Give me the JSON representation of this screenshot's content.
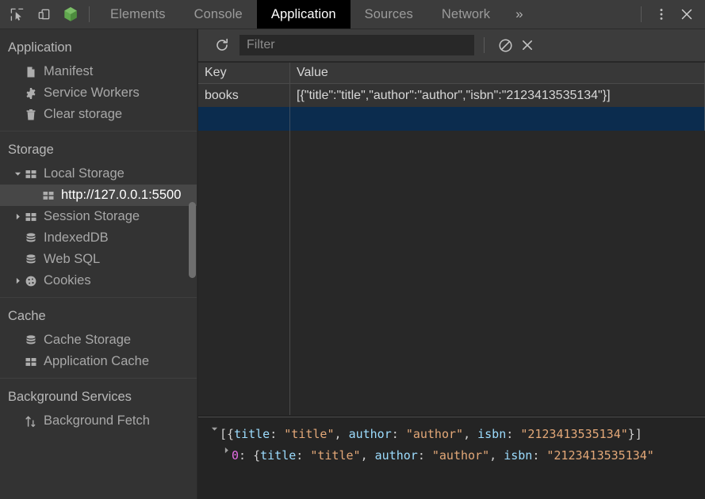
{
  "toolbar": {
    "inspect_icon": "inspect-cursor-icon",
    "device_icon": "device-toolbar-icon",
    "node_icon": "node-cube-icon",
    "more_tabs_label": "»",
    "menu_icon": "kebab-menu-icon",
    "close_icon": "close-icon",
    "tabs": [
      {
        "label": "Elements",
        "active": false
      },
      {
        "label": "Console",
        "active": false
      },
      {
        "label": "Application",
        "active": true
      },
      {
        "label": "Sources",
        "active": false
      },
      {
        "label": "Network",
        "active": false
      }
    ]
  },
  "sidebar": {
    "groups": [
      {
        "title": "Application",
        "items": [
          {
            "label": "Manifest",
            "icon": "document-icon",
            "twisty": "none",
            "selected": false,
            "indent": 1
          },
          {
            "label": "Service Workers",
            "icon": "gear-icon",
            "twisty": "none",
            "selected": false,
            "indent": 1
          },
          {
            "label": "Clear storage",
            "icon": "trash-icon",
            "twisty": "none",
            "selected": false,
            "indent": 1
          }
        ]
      },
      {
        "title": "Storage",
        "items": [
          {
            "label": "Local Storage",
            "icon": "table-grid-icon",
            "twisty": "expanded",
            "selected": false,
            "indent": 1
          },
          {
            "label": "http://127.0.0.1:5500",
            "icon": "table-grid-icon",
            "twisty": "none",
            "selected": true,
            "indent": 2
          },
          {
            "label": "Session Storage",
            "icon": "table-grid-icon",
            "twisty": "collapsed",
            "selected": false,
            "indent": 1
          },
          {
            "label": "IndexedDB",
            "icon": "database-icon",
            "twisty": "none",
            "selected": false,
            "indent": 1
          },
          {
            "label": "Web SQL",
            "icon": "database-icon",
            "twisty": "none",
            "selected": false,
            "indent": 1
          },
          {
            "label": "Cookies",
            "icon": "cookie-icon",
            "twisty": "collapsed",
            "selected": false,
            "indent": 1
          }
        ]
      },
      {
        "title": "Cache",
        "items": [
          {
            "label": "Cache Storage",
            "icon": "database-icon",
            "twisty": "none",
            "selected": false,
            "indent": 1
          },
          {
            "label": "Application Cache",
            "icon": "table-grid-icon",
            "twisty": "none",
            "selected": false,
            "indent": 1
          }
        ]
      },
      {
        "title": "Background Services",
        "items": [
          {
            "label": "Background Fetch",
            "icon": "updown-arrows-icon",
            "twisty": "none",
            "selected": false,
            "indent": 1
          }
        ]
      }
    ]
  },
  "panel": {
    "refresh_icon": "refresh-icon",
    "clear_icon": "no-entry-clear-icon",
    "delete_icon": "delete-x-icon",
    "filter": {
      "value": "",
      "placeholder": "Filter"
    },
    "table": {
      "columns": [
        "Key",
        "Value"
      ],
      "rows": [
        {
          "key": "books",
          "value": "[{\"title\":\"title\",\"author\":\"author\",\"isbn\":\"2123413535134\"}]",
          "selected": false
        },
        {
          "key": "",
          "value": "",
          "selected": true
        }
      ]
    },
    "preview": {
      "line1": {
        "twisty": "expanded",
        "tokens": [
          {
            "t": "[{",
            "c": "punct"
          },
          {
            "t": "title",
            "c": "key"
          },
          {
            "t": ": ",
            "c": "punct"
          },
          {
            "t": "\"title\"",
            "c": "str"
          },
          {
            "t": ", ",
            "c": "punct"
          },
          {
            "t": "author",
            "c": "key"
          },
          {
            "t": ": ",
            "c": "punct"
          },
          {
            "t": "\"author\"",
            "c": "str"
          },
          {
            "t": ", ",
            "c": "punct"
          },
          {
            "t": "isbn",
            "c": "key"
          },
          {
            "t": ": ",
            "c": "punct"
          },
          {
            "t": "\"2123413535134\"",
            "c": "str"
          },
          {
            "t": "}]",
            "c": "punct"
          }
        ]
      },
      "line2": {
        "twisty": "collapsed",
        "tokens": [
          {
            "t": "0",
            "c": "idx"
          },
          {
            "t": ": {",
            "c": "punct"
          },
          {
            "t": "title",
            "c": "key"
          },
          {
            "t": ": ",
            "c": "punct"
          },
          {
            "t": "\"title\"",
            "c": "str"
          },
          {
            "t": ", ",
            "c": "punct"
          },
          {
            "t": "author",
            "c": "key"
          },
          {
            "t": ": ",
            "c": "punct"
          },
          {
            "t": "\"author\"",
            "c": "str"
          },
          {
            "t": ", ",
            "c": "punct"
          },
          {
            "t": "isbn",
            "c": "key"
          },
          {
            "t": ": ",
            "c": "punct"
          },
          {
            "t": "\"2123413535134\"",
            "c": "str"
          }
        ]
      }
    }
  },
  "colors": {
    "tabbar_bg": "#3c3c3c",
    "active_tab_bg": "#000000",
    "sidebar_bg": "#333333",
    "sidebar_selected_bg": "#474747",
    "table_bg": "#282828",
    "row_bg": "#333333",
    "row_selected_bg": "#0b2c4e",
    "preview_bg": "#242424",
    "accent_node_green": "#5aa04f",
    "token_key": "#9cdcfe",
    "token_string": "#e3a878",
    "token_index": "#e56de5"
  }
}
